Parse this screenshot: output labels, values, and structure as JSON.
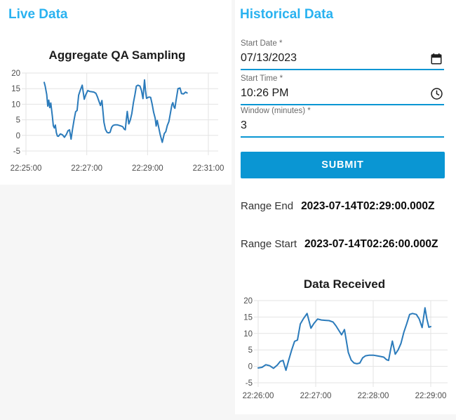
{
  "live_panel": {
    "title": "Live Data"
  },
  "historical_panel": {
    "title": "Historical Data",
    "form": {
      "start_date": {
        "label": "Start Date *",
        "value": "07/13/2023",
        "icon": "calendar-icon"
      },
      "start_time": {
        "label": "Start Time *",
        "value": "10:26 PM",
        "icon": "clock-icon"
      },
      "window": {
        "label": "Window (minutes) *",
        "value": "3"
      },
      "submit_label": "SUBMIT"
    },
    "results": {
      "range_end": {
        "label": "Range End",
        "value": "2023-07-14T02:29:00.000Z"
      },
      "range_start": {
        "label": "Range Start",
        "value": "2023-07-14T02:26:00.000Z"
      }
    }
  },
  "colors": {
    "accent": "#29b2f0",
    "primary": "#0a96d3",
    "line": "#2b7bbb",
    "grid": "#e3e3e3",
    "tick": "#4d4d4d"
  },
  "chart_data": [
    {
      "type": "line",
      "title": "Aggregate QA Sampling",
      "xlabel": "",
      "ylabel": "",
      "x_origin": "22:25:00",
      "x_domain_seconds": [
        0,
        360
      ],
      "xticks": [
        {
          "t": 0,
          "label": "22:25:00"
        },
        {
          "t": 120,
          "label": "22:27:00"
        },
        {
          "t": 240,
          "label": "22:29:00"
        },
        {
          "t": 360,
          "label": "22:31:00"
        }
      ],
      "ylim": [
        -5,
        20
      ],
      "yticks": [
        20,
        15,
        10,
        5,
        0,
        -5
      ],
      "grid": true,
      "legend": false,
      "points": [
        [
          36,
          17
        ],
        [
          38,
          15.8
        ],
        [
          41,
          13.1
        ],
        [
          43,
          9.4
        ],
        [
          45,
          11.3
        ],
        [
          47,
          8.9
        ],
        [
          49,
          10.4
        ],
        [
          52,
          6.2
        ],
        [
          54,
          3.1
        ],
        [
          56,
          2.4
        ],
        [
          58,
          3.3
        ],
        [
          60,
          0.9
        ],
        [
          62,
          -0.2
        ],
        [
          64,
          -0.3
        ],
        [
          68,
          0.5
        ],
        [
          72,
          0.2
        ],
        [
          76,
          -0.6
        ],
        [
          80,
          0.4
        ],
        [
          83,
          1.5
        ],
        [
          86,
          1.8
        ],
        [
          89,
          -1.2
        ],
        [
          92,
          2.0
        ],
        [
          95,
          5.0
        ],
        [
          98,
          7.6
        ],
        [
          101,
          8.0
        ],
        [
          104,
          12.9
        ],
        [
          107,
          14.4
        ],
        [
          111,
          16.1
        ],
        [
          115,
          11.6
        ],
        [
          118,
          13.0
        ],
        [
          122,
          14.4
        ],
        [
          126,
          14.1
        ],
        [
          130,
          14.0
        ],
        [
          134,
          13.9
        ],
        [
          138,
          13.5
        ],
        [
          141,
          12.4
        ],
        [
          144,
          11.0
        ],
        [
          147,
          9.6
        ],
        [
          150,
          11.2
        ],
        [
          154,
          4.2
        ],
        [
          157,
          1.9
        ],
        [
          160,
          1.0
        ],
        [
          163,
          0.8
        ],
        [
          166,
          1.0
        ],
        [
          169,
          2.6
        ],
        [
          172,
          3.2
        ],
        [
          176,
          3.4
        ],
        [
          180,
          3.4
        ],
        [
          184,
          3.2
        ],
        [
          188,
          3.0
        ],
        [
          191,
          2.8
        ],
        [
          194,
          2.0
        ],
        [
          196,
          1.8
        ],
        [
          198,
          4.9
        ],
        [
          200,
          7.7
        ],
        [
          203,
          3.7
        ],
        [
          206,
          5.0
        ],
        [
          209,
          7.0
        ],
        [
          212,
          10.4
        ],
        [
          215,
          13.0
        ],
        [
          218,
          15.8
        ],
        [
          221,
          16.1
        ],
        [
          225,
          15.8
        ],
        [
          228,
          14.4
        ],
        [
          231,
          11.8
        ],
        [
          234,
          17.8
        ],
        [
          236,
          14.4
        ],
        [
          238,
          11.9
        ],
        [
          240,
          12.1
        ],
        [
          243,
          12.3
        ],
        [
          246,
          12.2
        ],
        [
          249,
          10.1
        ],
        [
          252,
          7.4
        ],
        [
          255,
          5.5
        ],
        [
          257,
          3.0
        ],
        [
          259,
          4.8
        ],
        [
          262,
          2.6
        ],
        [
          265,
          0.2
        ],
        [
          269,
          -2.2
        ],
        [
          273,
          0.6
        ],
        [
          276,
          1.2
        ],
        [
          279,
          3.2
        ],
        [
          282,
          4.4
        ],
        [
          285,
          7.0
        ],
        [
          288,
          9.8
        ],
        [
          290,
          10.5
        ],
        [
          292,
          9.2
        ],
        [
          294,
          8.7
        ],
        [
          296,
          11.0
        ],
        [
          300,
          15.0
        ],
        [
          304,
          15.2
        ],
        [
          307,
          13.4
        ],
        [
          311,
          13.3
        ],
        [
          315,
          13.9
        ],
        [
          318,
          13.6
        ]
      ]
    },
    {
      "type": "line",
      "title": "Data Received",
      "xlabel": "",
      "ylabel": "",
      "x_origin": "22:26:00",
      "x_domain_seconds": [
        0,
        180
      ],
      "xticks": [
        {
          "t": 0,
          "label": "22:26:00"
        },
        {
          "t": 60,
          "label": "22:27:00"
        },
        {
          "t": 120,
          "label": "22:28:00"
        },
        {
          "t": 180,
          "label": "22:29:00"
        }
      ],
      "ylim": [
        -5,
        20
      ],
      "yticks": [
        20,
        15,
        10,
        5,
        0,
        -5
      ],
      "grid": true,
      "legend": false,
      "points": [
        [
          0,
          -0.5
        ],
        [
          4,
          -0.3
        ],
        [
          8,
          0.5
        ],
        [
          12,
          0.2
        ],
        [
          16,
          -0.6
        ],
        [
          20,
          0.4
        ],
        [
          23,
          1.5
        ],
        [
          26,
          1.8
        ],
        [
          29,
          -1.2
        ],
        [
          32,
          2.0
        ],
        [
          35,
          5.0
        ],
        [
          38,
          7.6
        ],
        [
          41,
          8.0
        ],
        [
          44,
          12.9
        ],
        [
          47,
          14.4
        ],
        [
          51,
          16.1
        ],
        [
          55,
          11.6
        ],
        [
          58,
          13.0
        ],
        [
          62,
          14.4
        ],
        [
          66,
          14.1
        ],
        [
          70,
          14.0
        ],
        [
          74,
          13.9
        ],
        [
          78,
          13.5
        ],
        [
          81,
          12.4
        ],
        [
          84,
          11.0
        ],
        [
          87,
          9.6
        ],
        [
          90,
          11.2
        ],
        [
          94,
          4.2
        ],
        [
          97,
          1.9
        ],
        [
          100,
          1.0
        ],
        [
          103,
          0.8
        ],
        [
          106,
          1.0
        ],
        [
          109,
          2.6
        ],
        [
          112,
          3.2
        ],
        [
          116,
          3.4
        ],
        [
          120,
          3.4
        ],
        [
          124,
          3.2
        ],
        [
          128,
          3.0
        ],
        [
          131,
          2.8
        ],
        [
          134,
          2.0
        ],
        [
          136,
          1.8
        ],
        [
          138,
          4.9
        ],
        [
          140,
          7.7
        ],
        [
          143,
          3.7
        ],
        [
          146,
          5.0
        ],
        [
          149,
          7.0
        ],
        [
          152,
          10.4
        ],
        [
          155,
          13.0
        ],
        [
          158,
          15.8
        ],
        [
          161,
          16.1
        ],
        [
          165,
          15.8
        ],
        [
          168,
          14.4
        ],
        [
          171,
          11.8
        ],
        [
          174,
          17.8
        ],
        [
          176,
          14.4
        ],
        [
          178,
          11.9
        ],
        [
          180,
          12.1
        ]
      ]
    }
  ]
}
